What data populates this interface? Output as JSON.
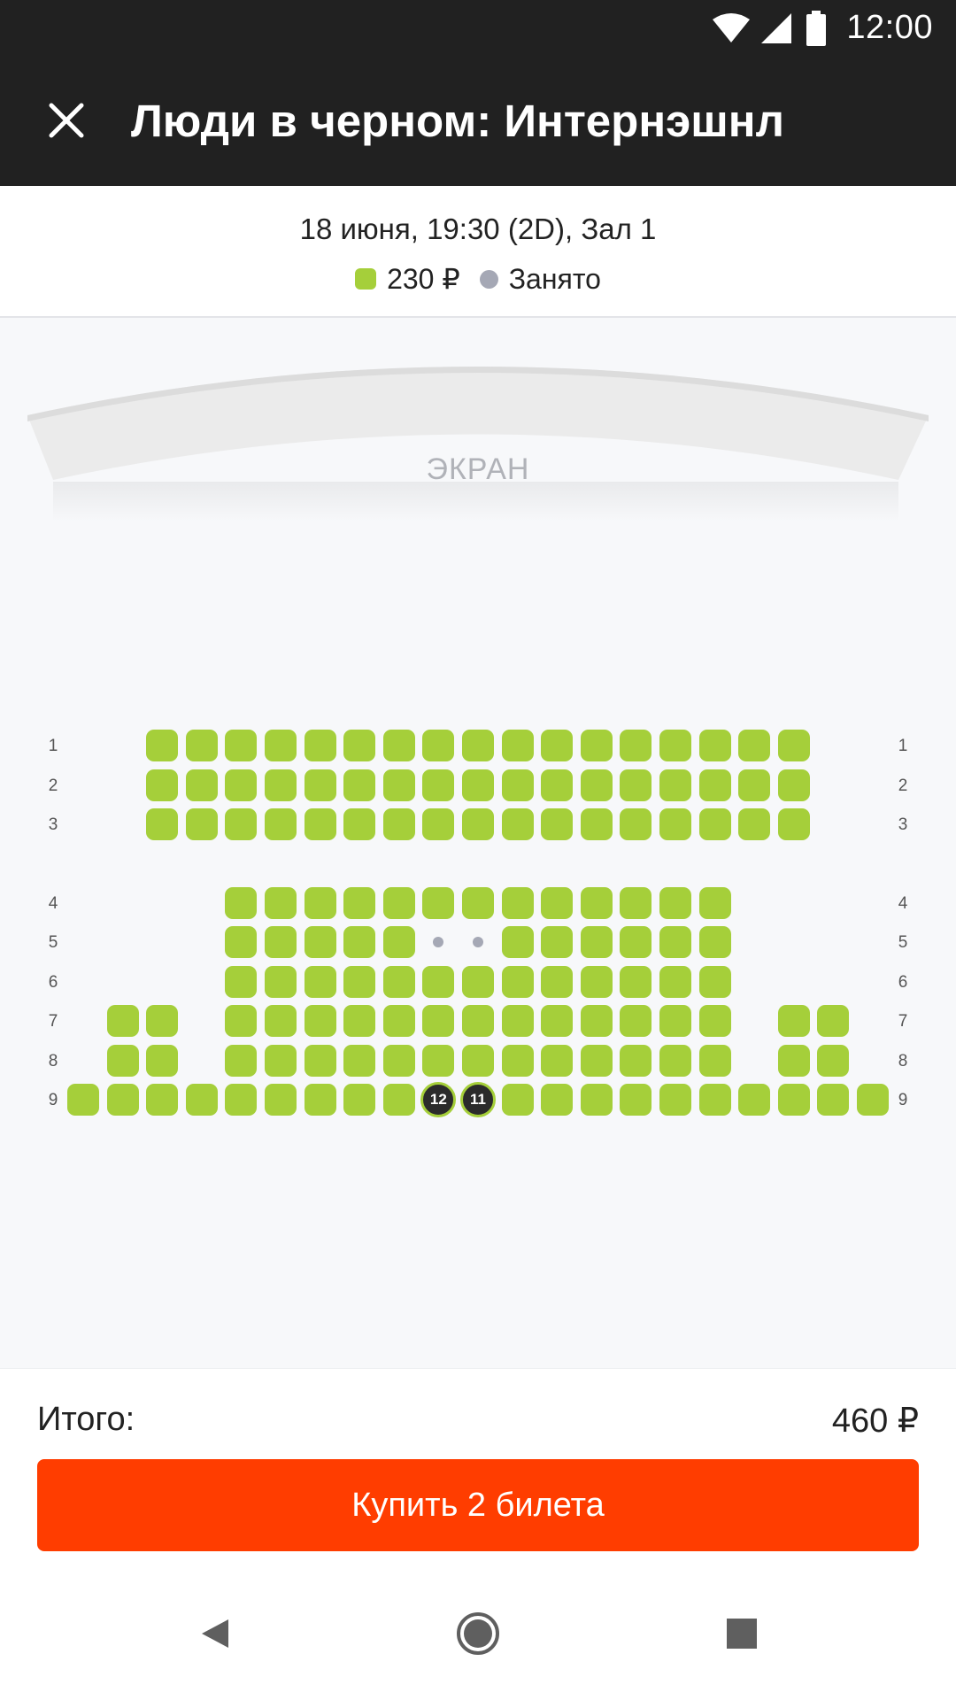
{
  "status_bar": {
    "time": "12:00",
    "icons": [
      "wifi-icon",
      "signal-icon",
      "battery-icon"
    ]
  },
  "app_bar": {
    "title": "Люди в черном: Интернэшнл",
    "close_icon": "close-icon"
  },
  "session": {
    "info": "18 июня, 19:30 (2D), Зал 1",
    "legend": {
      "price": "230 ₽",
      "occupied": "Занято"
    }
  },
  "hall": {
    "screen_label": "ЭКРАН",
    "rows": [
      {
        "num": "1",
        "seats": "ooooooooooooooooo"
      },
      {
        "num": "2",
        "seats": "ooooooooooooooooo"
      },
      {
        "num": "3",
        "seats": "ooooooooooooooooo"
      },
      {
        "num": "4",
        "seats": "ooooooooooooo"
      },
      {
        "num": "5",
        "seats": "ooooo..oooooo"
      },
      {
        "num": "6",
        "seats": "ooooooooooooo"
      },
      {
        "num": "7",
        "seats": "oo ooooooooooooo oo"
      },
      {
        "num": "8",
        "seats": "oo ooooooooooooo oo"
      },
      {
        "num": "9",
        "seats": "oooooooooSSoooooooooo"
      }
    ],
    "selected_seats": [
      "12",
      "11"
    ]
  },
  "footer": {
    "total_label": "Итого:",
    "total_value": "460 ₽",
    "buy_label": "Купить 2 билета"
  },
  "nav": {
    "items": [
      "back-icon",
      "home-icon",
      "recents-icon"
    ]
  },
  "colors": {
    "free": "#a5cf3a",
    "occupied": "#a5a8b5",
    "accent": "#ff3d00",
    "appbar": "#212121"
  }
}
